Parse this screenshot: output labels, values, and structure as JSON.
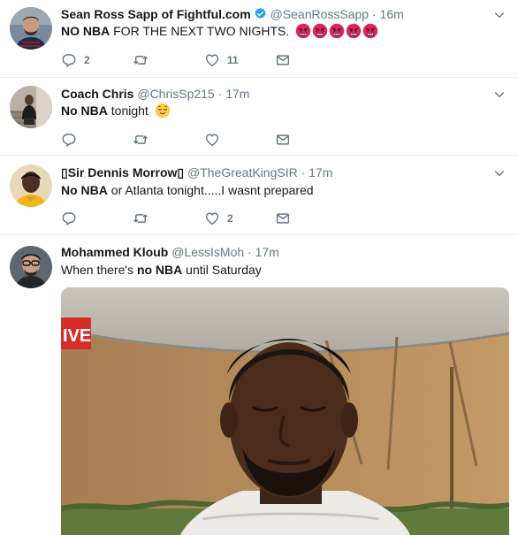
{
  "tweets": [
    {
      "name": "Sean Ross Sapp of Fightful.com",
      "handle": "@SeanRossSapp",
      "dot": "·",
      "time": "16m",
      "verified": true,
      "text_bold": "NO NBA",
      "text_rest": " FOR THE NEXT TWO NIGHTS.",
      "emoji": [
        "angry-face-emoji",
        "angry-face-emoji",
        "angry-face-emoji",
        "angry-face-emoji",
        "angry-face-emoji"
      ],
      "reply_count": "2",
      "retweet_count": "",
      "like_count": "11"
    },
    {
      "name": "Coach Chris",
      "handle": "@ChrisSp215",
      "dot": "·",
      "time": "17m",
      "text_bold": "No NBA",
      "text_rest": " tonight",
      "emoji": [
        "relieved-face-emoji"
      ],
      "reply_count": "",
      "retweet_count": "",
      "like_count": ""
    },
    {
      "name": "▯Sir Dennis Morrow▯",
      "handle": "@TheGreatKingSIR",
      "dot": "·",
      "time": "17m",
      "text_bold": "No NBA",
      "text_rest": " or Atlanta tonight.....I wasnt prepared",
      "reply_count": "",
      "retweet_count": "",
      "like_count": "2"
    },
    {
      "name": "Mohammed Kloub",
      "handle": "@LessIsMoh",
      "dot": "·",
      "time": "17m",
      "text_pre": "When there's ",
      "text_bold": "no NBA",
      "text_rest": " until Saturday",
      "photo_badge": "IVE"
    }
  ],
  "colors": {
    "text": "#14171a",
    "muted": "#657786",
    "verified": "#1da1f2",
    "divider": "#e6ecf0",
    "angry": "#e0245e"
  },
  "icons": {
    "reply": "reply-icon",
    "retweet": "retweet-icon",
    "like": "heart-icon",
    "dm": "envelope-icon",
    "menu": "chevron-down-icon"
  }
}
